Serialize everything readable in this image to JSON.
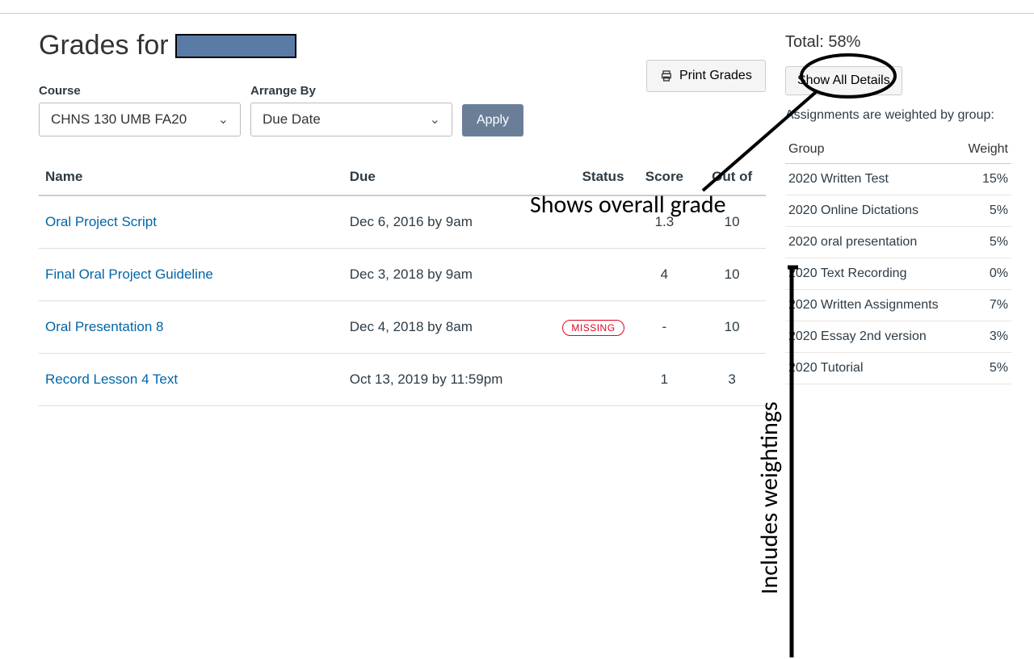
{
  "header": {
    "title_prefix": "Grades for",
    "print_label": "Print Grades"
  },
  "filters": {
    "course_label": "Course",
    "arrange_label": "Arrange By",
    "course_value": "CHNS 130 UMB FA20",
    "arrange_value": "Due Date",
    "apply_label": "Apply"
  },
  "table": {
    "col_name": "Name",
    "col_due": "Due",
    "col_status": "Status",
    "col_score": "Score",
    "col_outof": "Out of",
    "rows": [
      {
        "name": "Oral Project Script",
        "due": "Dec 6, 2016 by 9am",
        "status": "",
        "score": "1.3",
        "outof": "10"
      },
      {
        "name": "Final Oral Project Guideline",
        "due": "Dec 3, 2018 by 9am",
        "status": "",
        "score": "4",
        "outof": "10"
      },
      {
        "name": "Oral Presentation 8",
        "due": "Dec 4, 2018 by 8am",
        "status": "MISSING",
        "score": "-",
        "outof": "10"
      },
      {
        "name": "Record Lesson 4 Text",
        "due": "Oct 13, 2019 by 11:59pm",
        "status": "",
        "score": "1",
        "outof": "3"
      }
    ]
  },
  "sidebar": {
    "total_label": "Total: 58%",
    "details_label": "Show All Details",
    "weighted_text": "Assignments are weighted by group:",
    "col_group": "Group",
    "col_weight": "Weight",
    "groups": [
      {
        "name": "2020 Written Test",
        "weight": "15%"
      },
      {
        "name": "2020 Online Dictations",
        "weight": "5%"
      },
      {
        "name": "2020 oral presentation",
        "weight": "5%"
      },
      {
        "name": "2020 Text Recording",
        "weight": "0%"
      },
      {
        "name": "2020 Written Assignments",
        "weight": "7%"
      },
      {
        "name": "2020 Essay 2nd version",
        "weight": "3%"
      },
      {
        "name": "2020 Tutorial",
        "weight": "5%"
      }
    ]
  },
  "annotations": {
    "overall": "Shows overall grade",
    "weightings": "Includes weightings"
  }
}
